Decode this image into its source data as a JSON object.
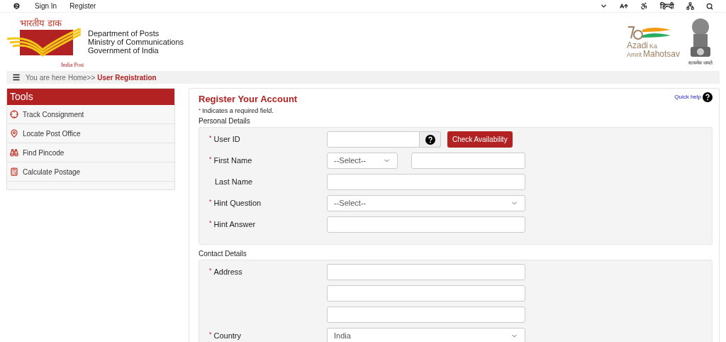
{
  "top_bar": {
    "links": [
      "Sign In",
      "Register"
    ],
    "language": "हिन्दी"
  },
  "header": {
    "logo_hindi": "भारतीय डाक",
    "logo_caption": "India Post",
    "org_lines": [
      "Department of Posts",
      "Ministry of Communications",
      "Government of India"
    ],
    "azadi": {
      "line1": "Azadi",
      "ka": "Ka",
      "amrit": "Amrit",
      "mahotsav": "Mahotsav"
    },
    "emblem_motto": "सत्यमेव जयते"
  },
  "breadcrumb": {
    "prefix": "You are here",
    "home": "Home>>",
    "current": "User Registration"
  },
  "sidebar": {
    "title": "Tools",
    "items": [
      {
        "label": "Track Consignment"
      },
      {
        "label": "Locate Post Office"
      },
      {
        "label": "Find Pincode"
      },
      {
        "label": "Calculate Postage"
      }
    ]
  },
  "form": {
    "title": "Register Your Account",
    "quick_help": "Quick help",
    "required_note_mark": "*",
    "required_note": "Indicates a required field.",
    "sections": [
      {
        "title": "Personal Details",
        "fields": [
          {
            "kind": "userid",
            "label": "User ID",
            "mark": "*",
            "button": "Check Availability"
          },
          {
            "kind": "name",
            "label": "First Name",
            "mark": "*",
            "value": "--Select--"
          },
          {
            "kind": "text",
            "label": "Last Name"
          },
          {
            "kind": "select",
            "label": "Hint Question",
            "mark": "*",
            "value": "--Select--"
          },
          {
            "kind": "text",
            "label": "Hint Answer",
            "mark": "*"
          }
        ]
      },
      {
        "title": "Contact Details",
        "fields": [
          {
            "kind": "multi",
            "label": "Address",
            "mark": "*"
          },
          {
            "kind": "select",
            "label": "Country",
            "mark": "*",
            "value": "India"
          }
        ]
      }
    ]
  }
}
